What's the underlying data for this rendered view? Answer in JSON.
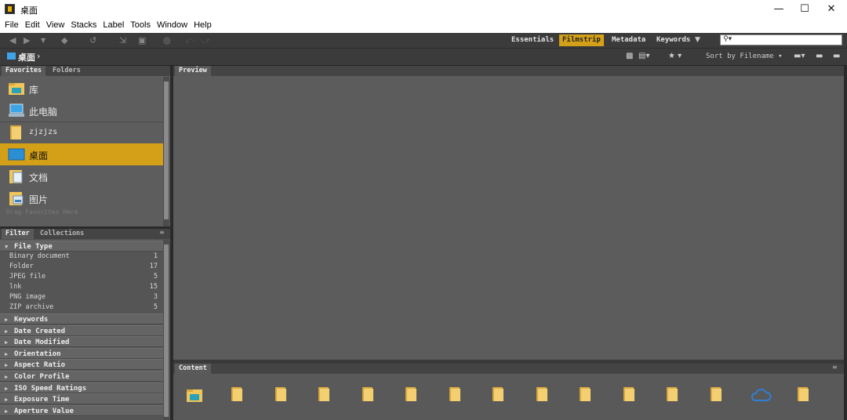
{
  "window": {
    "title": "桌面",
    "controls": {
      "minimize": "—",
      "maximize": "☐",
      "close": "✕"
    }
  },
  "menu": [
    "File",
    "Edit",
    "View",
    "Stacks",
    "Label",
    "Tools",
    "Window",
    "Help"
  ],
  "workspaces": {
    "items": [
      "Essentials",
      "Filmstrip",
      "Metadata",
      "Keywords"
    ],
    "active": "Filmstrip"
  },
  "search": {
    "icon": "search-icon",
    "value": ""
  },
  "path": {
    "current": "桌面",
    "chevron": "›"
  },
  "sort": {
    "label": "Sort by Filename"
  },
  "favorites": {
    "tabs": [
      "Favorites",
      "Folders"
    ],
    "items": [
      {
        "label": "库",
        "icon": "library-folder-icon"
      },
      {
        "label": "此电脑",
        "icon": "computer-icon"
      },
      {
        "label": "zjzjzs",
        "icon": "folder-icon"
      },
      {
        "label": "桌面",
        "icon": "desktop-icon",
        "selected": true
      },
      {
        "label": "文档",
        "icon": "documents-icon"
      },
      {
        "label": "图片",
        "icon": "pictures-icon"
      }
    ],
    "drop_hint": "Drag Favorites Here"
  },
  "filter": {
    "tabs": [
      "Filter",
      "Collections"
    ],
    "file_type": {
      "title": "File Type",
      "rows": [
        {
          "name": "Binary document",
          "count": "1"
        },
        {
          "name": "Folder",
          "count": "17"
        },
        {
          "name": "JPEG file",
          "count": "5"
        },
        {
          "name": "lnk",
          "count": "15"
        },
        {
          "name": "PNG image",
          "count": "3"
        },
        {
          "name": "ZIP archive",
          "count": "5"
        }
      ]
    },
    "sections": [
      "Keywords",
      "Date Created",
      "Date Modified",
      "Orientation",
      "Aspect Ratio",
      "Color Profile",
      "ISO Speed Ratings",
      "Exposure Time",
      "Aperture Value"
    ]
  },
  "preview": {
    "tab": "Preview"
  },
  "content": {
    "tab": "Content",
    "items": [
      "library-folder-icon",
      "folder-icon",
      "folder-icon",
      "folder-icon",
      "folder-icon",
      "folder-icon",
      "folder-icon",
      "folder-icon",
      "folder-icon",
      "folder-icon",
      "folder-icon",
      "folder-icon",
      "cloud-icon",
      "folder-icon"
    ]
  },
  "colors": {
    "accent": "#d4a017",
    "panel": "#5c5c5c",
    "folder": "#f3cf72",
    "cloud": "#2f7fd6"
  }
}
